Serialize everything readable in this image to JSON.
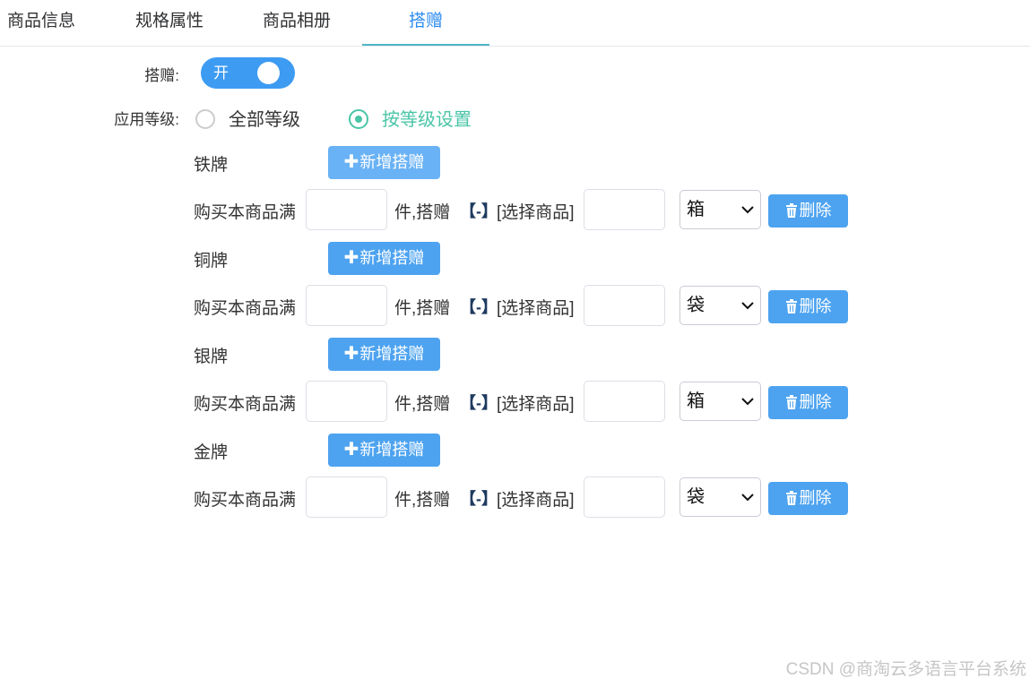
{
  "tabs": [
    {
      "label": "商品信息",
      "active": false
    },
    {
      "label": "规格属性",
      "active": false
    },
    {
      "label": "商品相册",
      "active": false
    },
    {
      "label": "搭赠",
      "active": true
    }
  ],
  "gift": {
    "label": "搭赠:",
    "switch_text": "开",
    "enabled": true
  },
  "apply_level": {
    "label": "应用等级:",
    "options": [
      {
        "label": "全部等级",
        "checked": false
      },
      {
        "label": "按等级设置",
        "checked": true
      }
    ]
  },
  "levels": [
    {
      "name": "铁牌",
      "unit": "箱"
    },
    {
      "name": "铜牌",
      "unit": "袋"
    },
    {
      "name": "银牌",
      "unit": "箱"
    },
    {
      "name": "金牌",
      "unit": "袋"
    }
  ],
  "row_labels": {
    "add_button": "新增搭赠",
    "buy_prefix": "购买本商品满",
    "piece_gift": "件,搭赠",
    "remove_bracket": "【-】",
    "select_product": "[选择商品]",
    "delete_button": "删除",
    "quantity_value": "",
    "gift_quantity_value": ""
  },
  "colors": {
    "accent": "#4da3f0",
    "switch_on": "#3d9bf2",
    "radio_checked": "#49c5a7",
    "tab_active_text": "#2d8cf0"
  },
  "watermark": "CSDN @商淘云多语言平台系统"
}
